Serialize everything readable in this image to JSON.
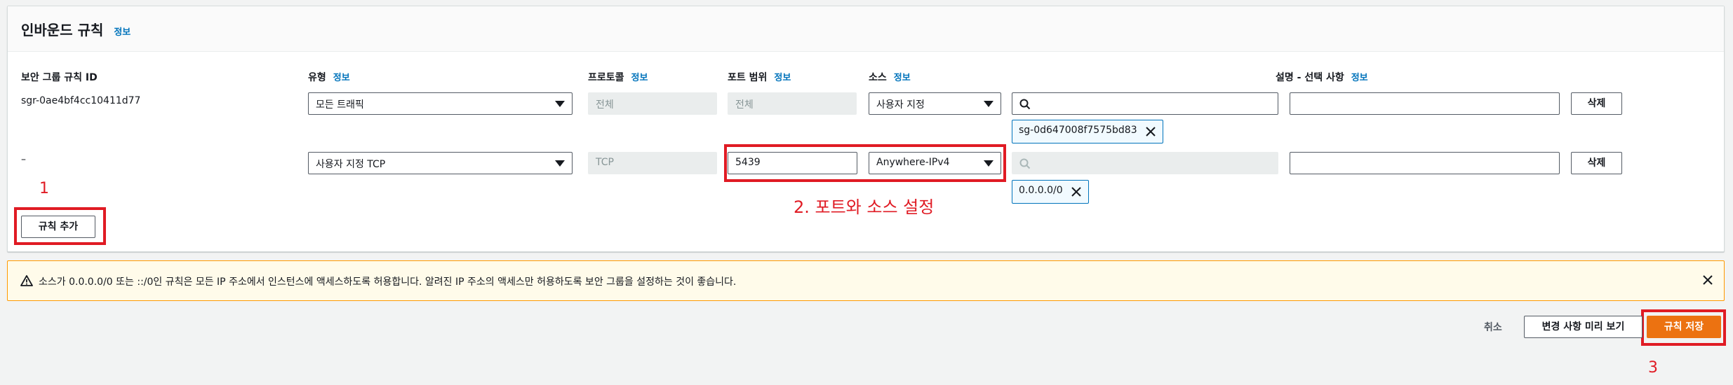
{
  "panel": {
    "title": "인바운드 규칙",
    "title_info": "정보"
  },
  "columns": {
    "rule_id": "보안 그룹 규칙 ID",
    "type": "유형",
    "type_info": "정보",
    "protocol": "프로토콜",
    "protocol_info": "정보",
    "port_range": "포트 범위",
    "port_range_info": "정보",
    "source": "소스",
    "source_info": "정보",
    "description": "설명 - 선택 사항",
    "description_info": "정보"
  },
  "rows": [
    {
      "rule_id": "sgr-0ae4bf4cc10411d77",
      "type": "모든 트래픽",
      "protocol": "전체",
      "port_range": "전체",
      "source_type": "사용자 지정",
      "source_search": "",
      "token": "sg-0d647008f7575bd83",
      "description": "",
      "delete_label": "삭제"
    },
    {
      "rule_id": "–",
      "type": "사용자 지정 TCP",
      "protocol": "TCP",
      "port_range": "5439",
      "source_type": "Anywhere-IPv4",
      "source_search": "",
      "token": "0.0.0.0/0",
      "description": "",
      "delete_label": "삭제"
    }
  ],
  "add_rule_label": "규칙 추가",
  "annotations": {
    "step1": "1",
    "step2": "2. 포트와 소스 설정",
    "step3": "3"
  },
  "alert": {
    "message": "소스가 0.0.0.0/0 또는 ::/0인 규칙은 모든 IP 주소에서 인스턴스에 액세스하도록 허용합니다. 알려진 IP 주소의 액세스만 허용하도록 보안 그룹을 설정하는 것이 좋습니다."
  },
  "footer": {
    "cancel_label": "취소",
    "preview_label": "변경 사항 미리 보기",
    "save_label": "규칙 저장"
  },
  "colors": {
    "accent": "#ec7211",
    "link": "#0073bb",
    "annotation": "#e01b24",
    "warning_bg": "#fffbea"
  }
}
